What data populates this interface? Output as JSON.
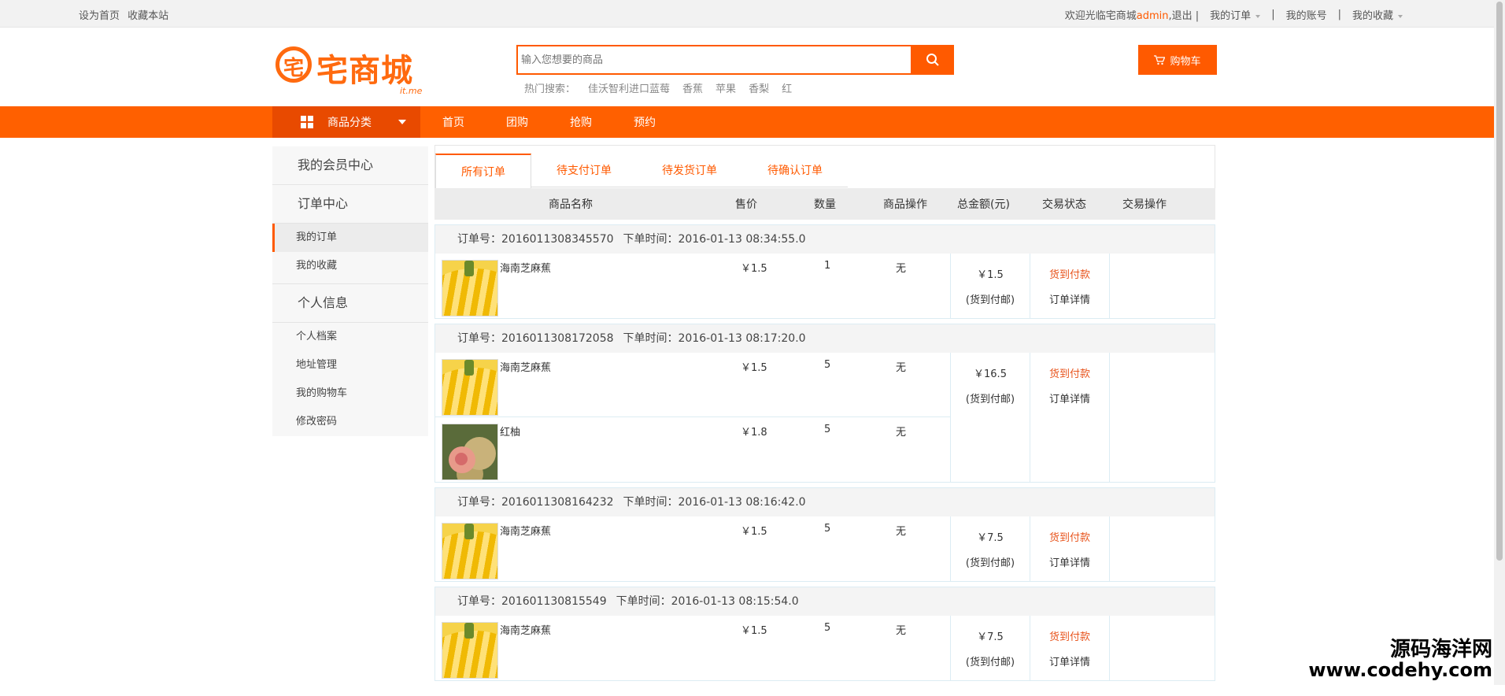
{
  "topbar": {
    "set_home": "设为首页",
    "bookmark": "收藏本站",
    "welcome": "欢迎光临宅商城",
    "user": "admin",
    "logout": ",退出 |",
    "my_orders": "我的订单",
    "sep1": "|",
    "my_account": "我的账号",
    "sep2": "|",
    "my_favorites": "我的收藏"
  },
  "header": {
    "logo_text": "宅商城",
    "logo_sub": "it.me",
    "search_placeholder": "输入您想要的商品",
    "hot_label": "热门搜索：",
    "hot_terms": [
      "佳沃智利进口蓝莓",
      "香蕉",
      "苹果",
      "香梨",
      "红"
    ],
    "cart_label": "购物车"
  },
  "nav": {
    "category": "商品分类",
    "links": [
      "首页",
      "团购",
      "抢购",
      "预约"
    ]
  },
  "sidebar": {
    "group_member": "我的会员中心",
    "group_orders": "订单中心",
    "orders_items": [
      "我的订单",
      "我的收藏"
    ],
    "group_profile": "个人信息",
    "profile_items": [
      "个人档案",
      "地址管理",
      "我的购物车",
      "修改密码"
    ]
  },
  "tabs": [
    "所有订单",
    "待支付订单",
    "待发货订单",
    "待确认订单"
  ],
  "table_headers": {
    "name": "商品名称",
    "price": "售价",
    "qty": "数量",
    "op": "商品操作",
    "total": "总金额(元)",
    "status": "交易状态",
    "action": "交易操作"
  },
  "orders": [
    {
      "no": "订单号：2016011308345570",
      "time": "下单时间：2016-01-13 08:34:55.0",
      "items": [
        {
          "name": "海南芝麻蕉",
          "price": "￥1.5",
          "qty": "1",
          "op": "无",
          "pic": "banana"
        }
      ],
      "total": "￥1.5",
      "pay_method": "(货到付邮)",
      "status": "货到付款",
      "detail": "订单详情"
    },
    {
      "no": "订单号：201601130817205­8",
      "time": "下单时间：2016-01-13 08:17:20.0",
      "items": [
        {
          "name": "海南芝麻蕉",
          "price": "￥1.5",
          "qty": "5",
          "op": "无",
          "pic": "banana"
        },
        {
          "name": "红柚",
          "price": "￥1.8",
          "qty": "5",
          "op": "无",
          "pic": "pomelo"
        }
      ],
      "total": "￥16.5",
      "pay_method": "(货到付邮)",
      "status": "货到付款",
      "detail": "订单详情"
    },
    {
      "no": "订单号：2016011308164232",
      "time": "下单时间：2016-01-13 08:16:42.0",
      "items": [
        {
          "name": "海南芝麻蕉",
          "price": "￥1.5",
          "qty": "5",
          "op": "无",
          "pic": "banana"
        }
      ],
      "total": "￥7.5",
      "pay_method": "(货到付邮)",
      "status": "货到付款",
      "detail": "订单详情"
    },
    {
      "no": "订单号：201601130815549",
      "time": "下单时间：2016-01-13 08:15:54.0",
      "items": [
        {
          "name": "海南芝麻蕉",
          "price": "￥1.5",
          "qty": "5",
          "op": "无",
          "pic": "banana"
        }
      ],
      "total": "￥7.5",
      "pay_method": "(货到付邮)",
      "status": "货到付款",
      "detail": "订单详情"
    }
  ],
  "watermark": {
    "line1": "源码海洋网",
    "line2": "www.codehy.com"
  },
  "colors": {
    "accent": "#ff6000",
    "status": "#e8541d"
  }
}
